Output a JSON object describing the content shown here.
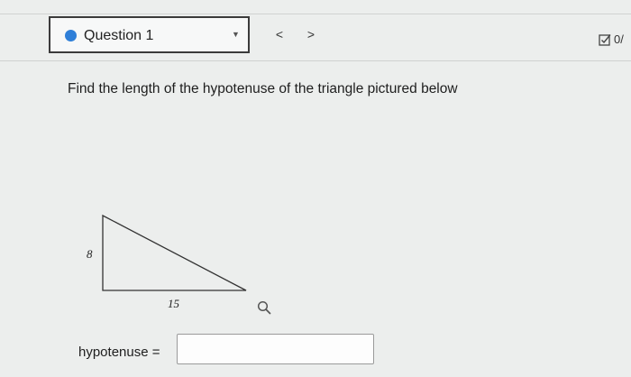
{
  "header": {
    "question_label": "Question 1",
    "prev_label": "<",
    "next_label": ">",
    "score_text": "0/",
    "status_color": "#2f7fd8"
  },
  "question": {
    "prompt": "Find the length of the hypotenuse of the triangle pictured below",
    "figure": {
      "vertical_leg_label": "8",
      "horizontal_leg_label": "15"
    }
  },
  "answer": {
    "label": "hypotenuse =",
    "value": ""
  },
  "icons": {
    "status": "status-dot-icon",
    "dropdown": "chevron-down-icon",
    "score": "checkbox-icon",
    "zoom": "magnifier-icon"
  }
}
